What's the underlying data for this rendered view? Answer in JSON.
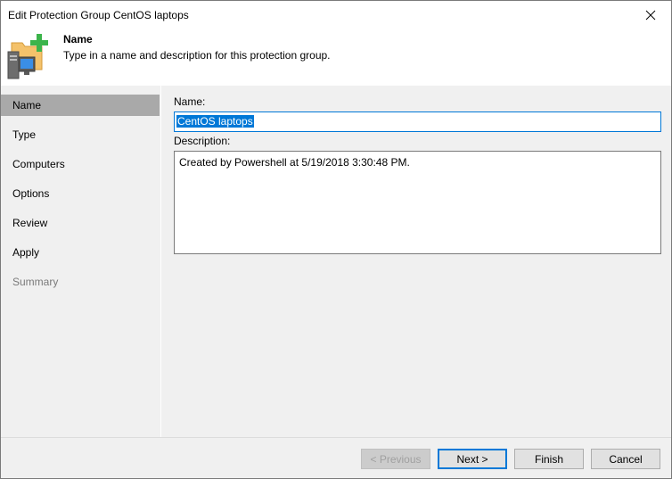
{
  "window": {
    "title": "Edit Protection Group CentOS laptops"
  },
  "header": {
    "title": "Name",
    "description": "Type in a name and description for this protection group."
  },
  "sidebar": {
    "items": [
      {
        "label": "Name",
        "state": "selected"
      },
      {
        "label": "Type",
        "state": "normal"
      },
      {
        "label": "Computers",
        "state": "normal"
      },
      {
        "label": "Options",
        "state": "normal"
      },
      {
        "label": "Review",
        "state": "normal"
      },
      {
        "label": "Apply",
        "state": "normal"
      },
      {
        "label": "Summary",
        "state": "disabled"
      }
    ]
  },
  "form": {
    "name_label": "Name:",
    "name_value": "CentOS laptops",
    "description_label": "Description:",
    "description_value": "Created by Powershell at 5/19/2018 3:30:48 PM."
  },
  "footer": {
    "previous_label": "< Previous",
    "next_label": "Next >",
    "finish_label": "Finish",
    "cancel_label": "Cancel"
  },
  "colors": {
    "accent": "#0078d7",
    "selected_nav": "#a9a9a9",
    "panel_bg": "#f0f0f0",
    "folder": "#f4c26b",
    "plus": "#3cb44b"
  }
}
